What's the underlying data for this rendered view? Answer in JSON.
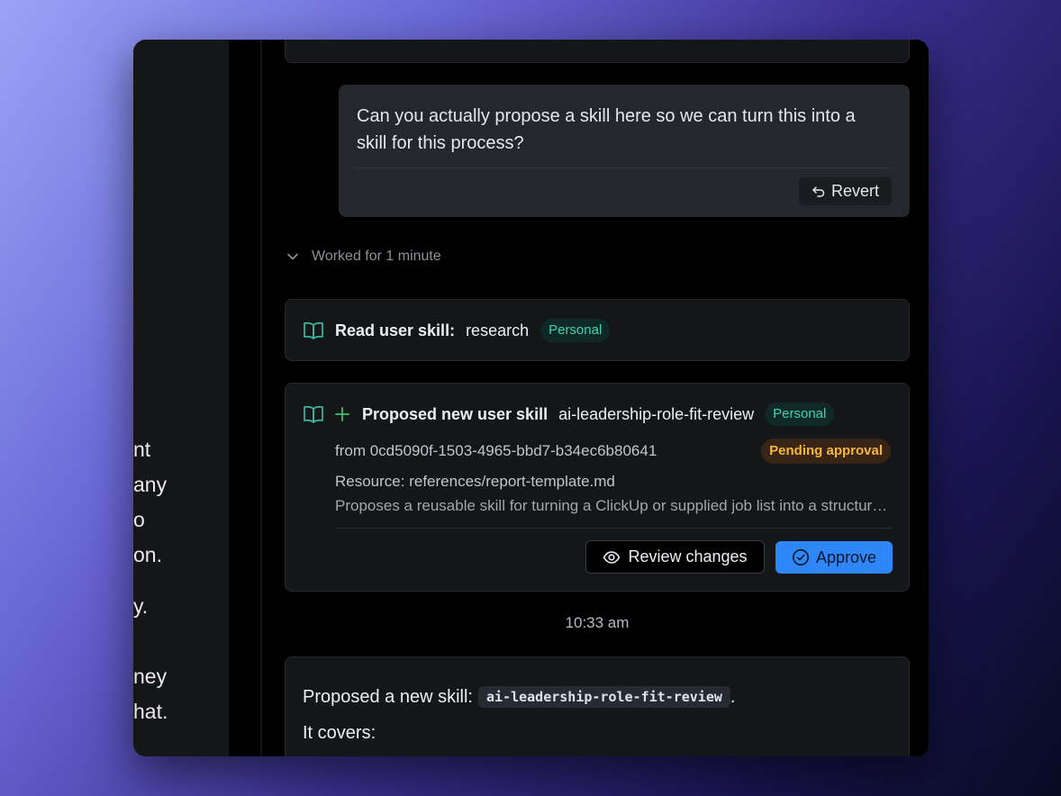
{
  "left_panel": {
    "fragments": [
      "nt",
      "any",
      "o",
      "on.",
      "y.",
      "ney",
      "hat."
    ]
  },
  "user_message": {
    "text": "Can you actually propose a skill here so we can turn this into a skill for this process?",
    "revert_label": "Revert"
  },
  "worked": {
    "label": "Worked for 1 minute"
  },
  "read_skill": {
    "label": "Read user skill:",
    "name": "research",
    "badge": "Personal"
  },
  "proposed_skill": {
    "label": "Proposed new user skill",
    "name": "ai-leadership-role-fit-review",
    "badge": "Personal",
    "from": "from 0cd5090f-1503-4965-bbd7-b34ec6b80641",
    "status": "Pending approval",
    "resource": "Resource: references/report-template.md",
    "description": "Proposes a reusable skill for turning a ClickUp or supplied job list into a structured role-fit review",
    "review_label": "Review changes",
    "approve_label": "Approve"
  },
  "timestamp": "10:33 am",
  "reply": {
    "intro": "Proposed a new skill:",
    "code": "ai-leadership-role-fit-review",
    "period": ".",
    "covers": "It covers:"
  },
  "colors": {
    "accent_blue": "#2f86f6",
    "personal_badge_text": "#3ed3b0",
    "pending_badge_text": "#f3b73b",
    "plus_green": "#3fbf6f"
  },
  "icons": [
    "undo-icon",
    "chevron-down-icon",
    "book-open-icon",
    "plus-icon",
    "eye-icon",
    "check-circle-icon"
  ]
}
